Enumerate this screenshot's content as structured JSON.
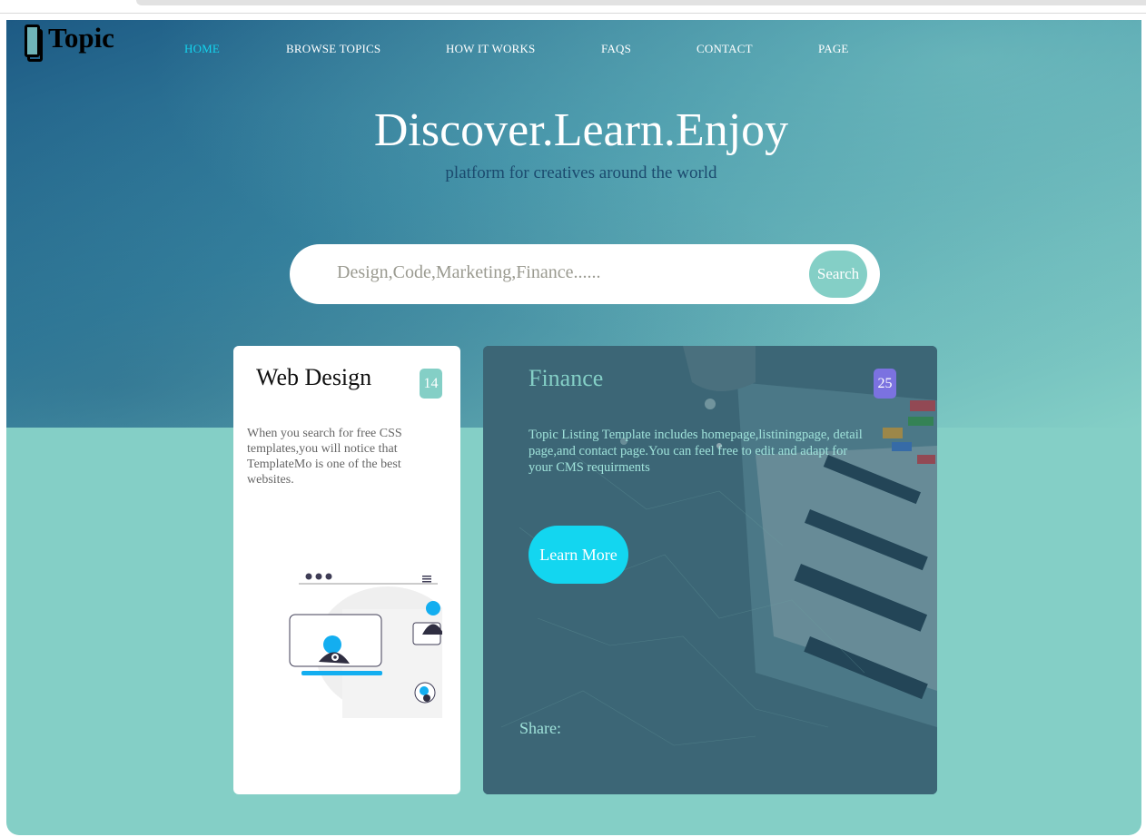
{
  "brand": {
    "name": "Topic"
  },
  "nav": {
    "items": [
      {
        "label": "HOME",
        "active": true
      },
      {
        "label": "BROWSE TOPICS",
        "active": false
      },
      {
        "label": "HOW IT WORKS",
        "active": false
      },
      {
        "label": "FAQS",
        "active": false
      },
      {
        "label": "CONTACT",
        "active": false
      },
      {
        "label": "PAGE",
        "active": false
      }
    ]
  },
  "hero": {
    "title": "Discover.Learn.Enjoy",
    "subtitle": "platform for creatives around the world"
  },
  "search": {
    "placeholder": "Design,Code,Marketing,Finance......",
    "button_label": "Search"
  },
  "cards": [
    {
      "title": "Web Design",
      "badge": "14",
      "description": "When you search for free CSS templates,you will notice that TemplateMo is one of the best websites."
    },
    {
      "title": "Finance",
      "badge": "25",
      "description": "Topic Listing Template includes homepage,listiningpage, detail page,and contact page.You can feel free to edit and adapt for your CMS requirments",
      "button_label": "Learn More",
      "share_label": "Share:"
    }
  ],
  "colors": {
    "accent": "#13d6f0",
    "teal": "#84cfc6",
    "badge_purple": "#7b72e0"
  }
}
